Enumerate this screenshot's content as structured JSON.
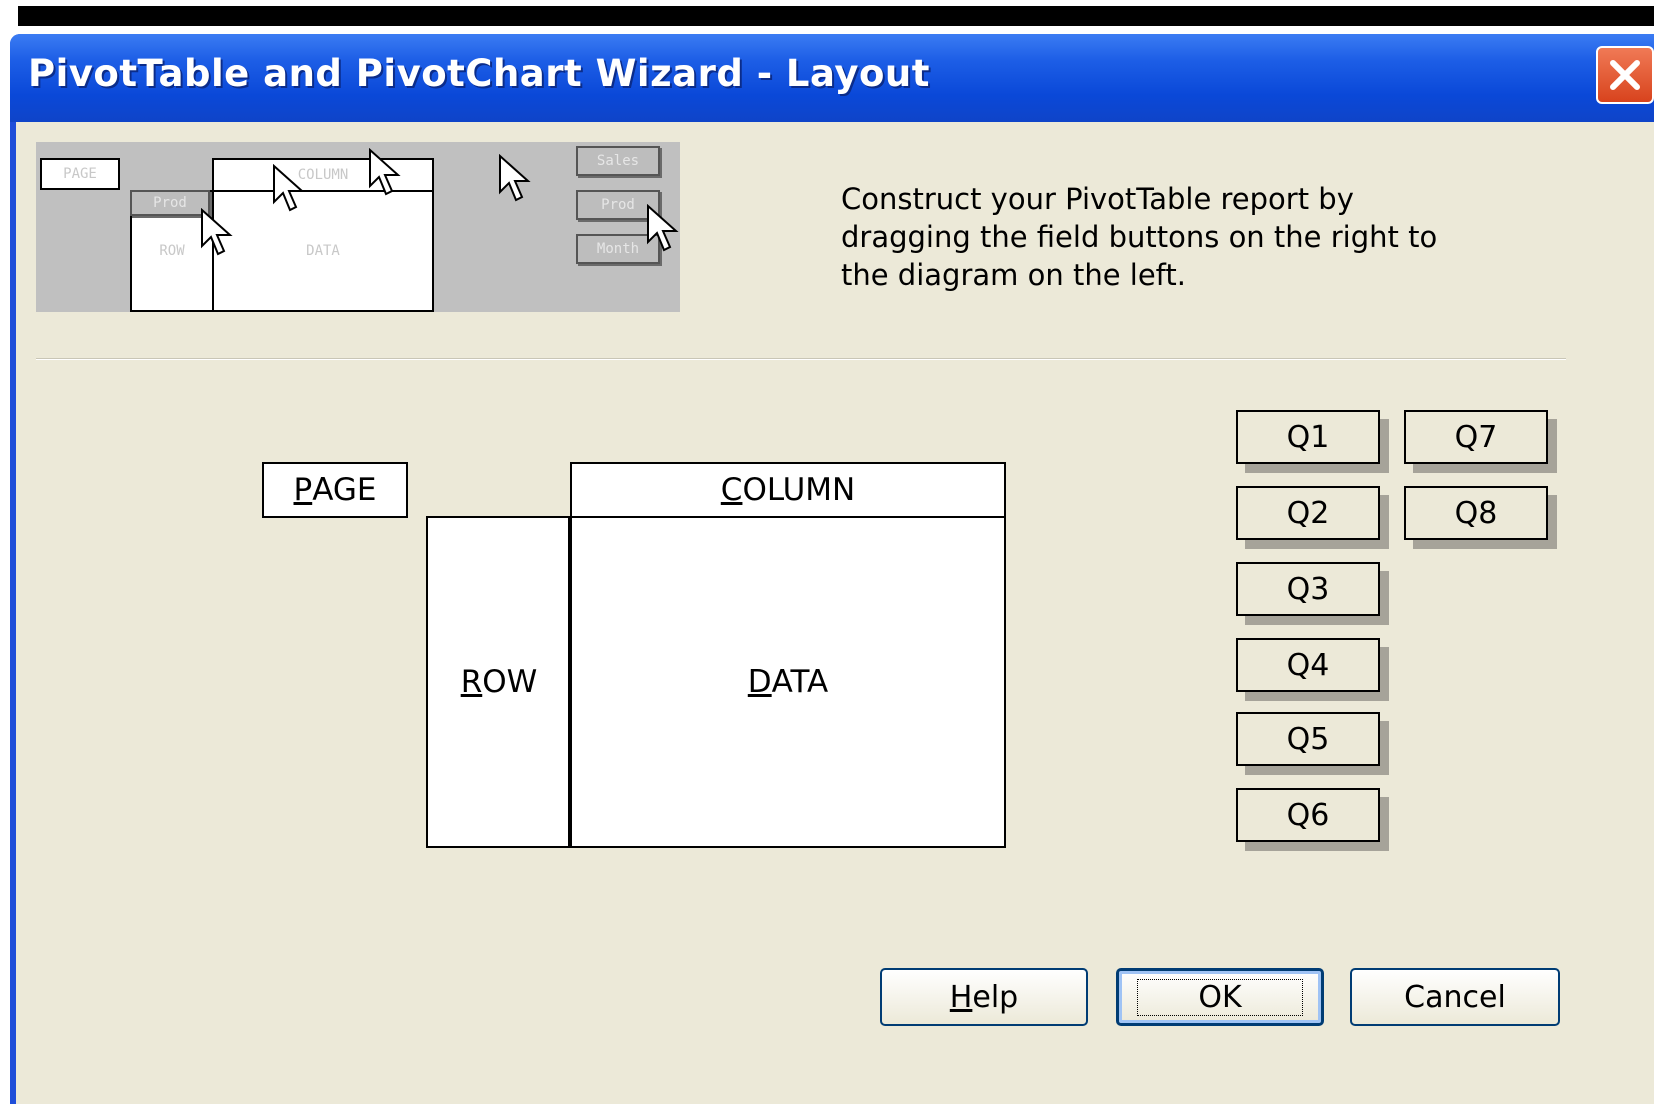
{
  "window": {
    "title": "PivotTable and PivotChart Wizard - Layout",
    "close_icon": "close-icon"
  },
  "preview": {
    "page": "PAGE",
    "column": "COLUMN",
    "row": "ROW",
    "data": "DATA",
    "prod_row_btn": "Prod",
    "field_buttons": [
      "Sales",
      "Prod",
      "Month"
    ]
  },
  "instructions": "Construct your PivotTable report by dragging the field buttons on the right to the diagram on the left.",
  "layout": {
    "page": {
      "prefix": "",
      "accel": "P",
      "rest": "AGE"
    },
    "column": {
      "prefix": "",
      "accel": "C",
      "rest": "OLUMN"
    },
    "row": {
      "prefix": "",
      "accel": "R",
      "rest": "OW"
    },
    "data": {
      "prefix": "",
      "accel": "D",
      "rest": "ATA"
    }
  },
  "fields": [
    "Q1",
    "Q2",
    "Q3",
    "Q4",
    "Q5",
    "Q6",
    "Q7",
    "Q8"
  ],
  "buttons": {
    "help": {
      "accel": "H",
      "rest": "elp"
    },
    "ok": "OK",
    "cancel": "Cancel"
  },
  "colors": {
    "titlebar": "#0a48d8",
    "client": "#ece9d8",
    "close": "#d8431d"
  }
}
